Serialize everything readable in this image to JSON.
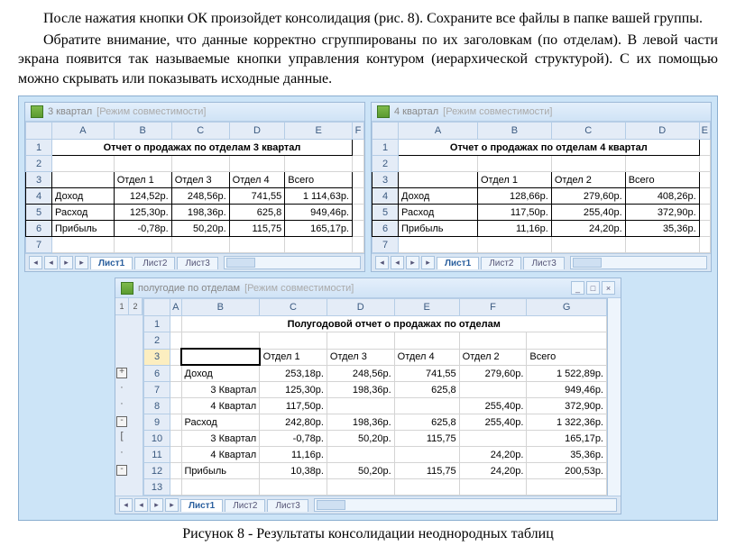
{
  "para1": "После нажатия кнопки ОК произойдет консолидация (рис. 8). Сохраните все файлы в папке вашей группы.",
  "para2": "Обратите внимание, что данные корректно сгруппированы по их заголовкам (по отделам). В левой части экрана появится так называемые кнопки управления контуром (иерархической структурой). С их помощью можно скрывать или показывать исходные данные.",
  "caption": "Рисунок 8 - Результаты консолидации неоднородных таблиц",
  "win1": {
    "title": "3 квартал",
    "mode": "[Режим совместимости]",
    "header": "Отчет о продажах по отделам 3 квартал",
    "cols": [
      "Отдел 1",
      "Отдел 3",
      "Отдел 4",
      "Всего"
    ],
    "rows": [
      {
        "label": "Доход",
        "v": [
          "124,52p.",
          "248,56p.",
          "741,55",
          "1 114,63p."
        ]
      },
      {
        "label": "Расход",
        "v": [
          "125,30p.",
          "198,36p.",
          "625,8",
          "949,46p."
        ]
      },
      {
        "label": "Прибыль",
        "v": [
          "-0,78p.",
          "50,20p.",
          "115,75",
          "165,17p."
        ]
      }
    ]
  },
  "win2": {
    "title": "4 квартал",
    "mode": "[Режим совместимости]",
    "header": "Отчет о продажах по отделам 4 квартал",
    "cols": [
      "Отдел 1",
      "Отдел 2",
      "Всего"
    ],
    "rows": [
      {
        "label": "Доход",
        "v": [
          "128,66p.",
          "279,60p.",
          "408,26p."
        ]
      },
      {
        "label": "Расход",
        "v": [
          "117,50p.",
          "255,40p.",
          "372,90p."
        ]
      },
      {
        "label": "Прибыль",
        "v": [
          "11,16p.",
          "24,20p.",
          "35,36p."
        ]
      }
    ]
  },
  "win3": {
    "title": "полугодие по отделам",
    "mode": "[Режим совместимости]",
    "header": "Полугодовой отчет о продажах по отделам",
    "cols": [
      "Отдел 1",
      "Отдел 3",
      "Отдел 4",
      "Отдел 2",
      "Всего"
    ],
    "rows": [
      {
        "n": 6,
        "o": "+",
        "label": "Доход",
        "v": [
          "253,18p.",
          "248,56p.",
          "741,55",
          "279,60p.",
          "1 522,89p."
        ]
      },
      {
        "n": 7,
        "o": ".",
        "label": "3 Квартал",
        "v": [
          "125,30p.",
          "198,36p.",
          "625,8",
          "",
          "949,46p."
        ]
      },
      {
        "n": 8,
        "o": ".",
        "label": "4 Квартал",
        "v": [
          "117,50p.",
          "",
          "",
          "255,40p.",
          "372,90p."
        ]
      },
      {
        "n": 9,
        "o": "-",
        "label": "Расход",
        "v": [
          "242,80p.",
          "198,36p.",
          "625,8",
          "255,40p.",
          "1 322,36p."
        ]
      },
      {
        "n": 10,
        "o": "[",
        "label": "3 Квартал",
        "v": [
          "-0,78p.",
          "50,20p.",
          "115,75",
          "",
          "165,17p."
        ]
      },
      {
        "n": 11,
        "o": ".",
        "label": "4 Квартал",
        "v": [
          "11,16p.",
          "",
          "",
          "24,20p.",
          "35,36p."
        ]
      },
      {
        "n": 12,
        "o": "-",
        "label": "Прибыль",
        "v": [
          "10,38p.",
          "50,20p.",
          "115,75",
          "24,20p.",
          "200,53p."
        ]
      },
      {
        "n": 13,
        "o": "",
        "label": "",
        "v": [
          "",
          "",
          "",
          "",
          ""
        ]
      }
    ]
  },
  "tabs": {
    "t1": "Лист1",
    "t2": "Лист2",
    "t3": "Лист3"
  },
  "colLetters": [
    "A",
    "B",
    "C",
    "D",
    "E",
    "F",
    "G"
  ]
}
